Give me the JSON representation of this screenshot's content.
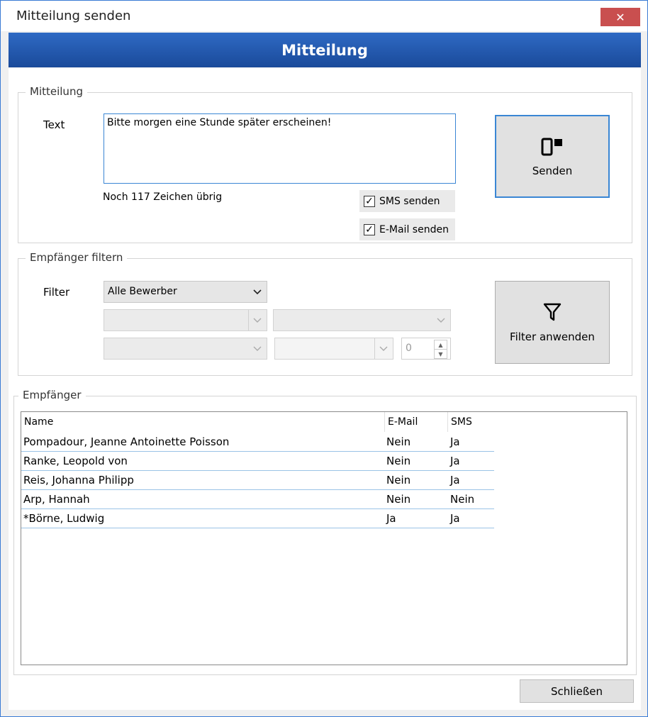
{
  "window": {
    "title": "Mitteilung senden",
    "close_glyph": "✕"
  },
  "banner": {
    "title": "Mitteilung"
  },
  "message_group": {
    "legend": "Mitteilung",
    "text_label": "Text",
    "text_value": "Bitte morgen eine Stunde später erscheinen!",
    "remaining": "Noch 117 Zeichen übrig",
    "sms_label": "SMS senden",
    "sms_checked": true,
    "email_label": "E-Mail senden",
    "email_checked": true,
    "send_button": "Senden",
    "send_icon": "phone-mail-icon"
  },
  "filter_group": {
    "legend": "Empfänger filtern",
    "filter_label": "Filter",
    "filter_value": "Alle Bewerber",
    "spin_value": "0",
    "apply_button": "Filter anwenden",
    "apply_icon": "funnel-icon"
  },
  "recipients": {
    "legend": "Empfänger",
    "columns": [
      "Name",
      "E-Mail",
      "SMS"
    ],
    "rows": [
      {
        "name": "Pompadour, Jeanne Antoinette Poisson",
        "email": "Nein",
        "sms": "Ja"
      },
      {
        "name": "Ranke, Leopold von",
        "email": "Nein",
        "sms": "Ja"
      },
      {
        "name": "Reis, Johanna Philipp",
        "email": "Nein",
        "sms": "Ja"
      },
      {
        "name": "Arp, Hannah",
        "email": "Nein",
        "sms": "Nein"
      },
      {
        "name": "*Börne, Ludwig",
        "email": "Ja",
        "sms": "Ja"
      }
    ]
  },
  "footer": {
    "close_button": "Schließen"
  },
  "colors": {
    "accent": "#3a86d4",
    "banner_top": "#2f6ac4",
    "banner_bottom": "#1a4a9a",
    "close_red": "#c94f4f"
  }
}
